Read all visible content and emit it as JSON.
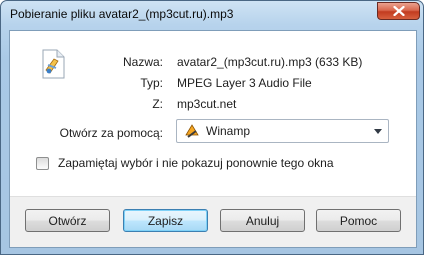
{
  "window": {
    "title": "Pobieranie pliku avatar2_(mp3cut.ru).mp3",
    "close_icon": "close-icon"
  },
  "file": {
    "icon": "audio-file-icon",
    "name_label": "Nazwa:",
    "name_value": "avatar2_(mp3cut.ru).mp3 (633 KB)",
    "type_label": "Typ:",
    "type_value": "MPEG Layer 3 Audio File",
    "from_label": "Z:",
    "from_value": "mp3cut.net"
  },
  "open_with": {
    "label": "Otwórz za pomocą:",
    "selected": "Winamp",
    "selected_icon": "winamp-icon"
  },
  "remember": {
    "label": "Zapamiętaj wybór i nie pokazuj ponownie tego okna",
    "checked": false
  },
  "buttons": {
    "open": "Otwórz",
    "save": "Zapisz",
    "cancel": "Anuluj",
    "help": "Pomoc"
  },
  "colors": {
    "default_button_border": "#3c7fb1",
    "close_button": "#c23b20"
  }
}
